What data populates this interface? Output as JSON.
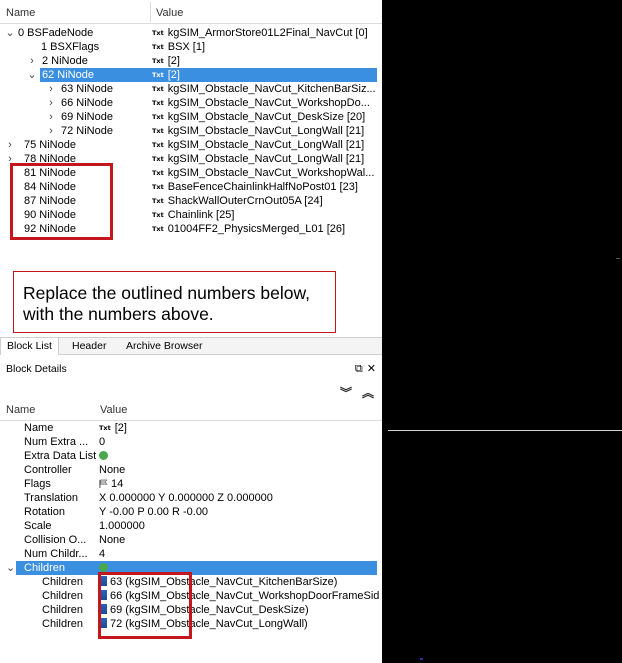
{
  "tree": {
    "col_name": "Name",
    "col_value": "Value",
    "rows": [
      {
        "arrow": "⌄",
        "name": "0 BSFadeNode",
        "txt": "Txt",
        "value": "kgSIM_ArmorStore01L2Final_NavCut [0]"
      },
      {
        "arrow": "",
        "name": "1 BSXFlags",
        "txt": "Txt",
        "value": "BSX [1]"
      },
      {
        "arrow": "›",
        "name": "2 NiNode",
        "txt": "Txt",
        "value": "[2]"
      },
      {
        "arrow": "⌄",
        "name": "62 NiNode",
        "txt": "Txt",
        "value": "[2]"
      },
      {
        "arrow": "›",
        "name": "63 NiNode",
        "txt": "Txt",
        "value": "kgSIM_Obstacle_NavCut_KitchenBarSiz..."
      },
      {
        "arrow": "›",
        "name": "66 NiNode",
        "txt": "Txt",
        "value": "kgSIM_Obstacle_NavCut_WorkshopDo..."
      },
      {
        "arrow": "›",
        "name": "69 NiNode",
        "txt": "Txt",
        "value": "kgSIM_Obstacle_NavCut_DeskSize [20]"
      },
      {
        "arrow": "›",
        "name": "72 NiNode",
        "txt": "Txt",
        "value": "kgSIM_Obstacle_NavCut_LongWall [21]"
      },
      {
        "arrow": "›",
        "name": "75 NiNode",
        "txt": "Txt",
        "value": "kgSIM_Obstacle_NavCut_LongWall [21]"
      },
      {
        "arrow": "›",
        "name": "78 NiNode",
        "txt": "Txt",
        "value": "kgSIM_Obstacle_NavCut_LongWall [21]"
      },
      {
        "arrow": "",
        "name": "81 NiNode",
        "txt": "Txt",
        "value": "kgSIM_Obstacle_NavCut_WorkshopWal..."
      },
      {
        "arrow": "",
        "name": "84 NiNode",
        "txt": "Txt",
        "value": "BaseFenceChainlinkHalfNoPost01 [23]"
      },
      {
        "arrow": "",
        "name": "87 NiNode",
        "txt": "Txt",
        "value": "ShackWallOuterCrnOut05A [24]"
      },
      {
        "arrow": "",
        "name": "90 NiNode",
        "txt": "Txt",
        "value": "Chainlink [25]"
      },
      {
        "arrow": "",
        "name": "92 NiNode",
        "txt": "Txt",
        "value": "01004FF2_PhysicsMerged_L01 [26]"
      }
    ]
  },
  "annotation": {
    "text": "Replace the outlined numbers below, with the numbers above."
  },
  "tabs": [
    "Block List",
    "Header",
    "Archive Browser"
  ],
  "block_details": {
    "title": "Block Details",
    "col_name": "Name",
    "col_value": "Value",
    "rows": [
      {
        "name": "Name",
        "value": "[2]",
        "txt": "Txt"
      },
      {
        "name": "Num Extra ...",
        "value": "0"
      },
      {
        "name": "Extra Data List",
        "value": ""
      },
      {
        "name": "Controller",
        "value": "None"
      },
      {
        "name": "Flags",
        "value": "14"
      },
      {
        "name": "Translation",
        "value": "X 0.000000 Y 0.000000 Z 0.000000"
      },
      {
        "name": "Rotation",
        "value": "Y -0.00 P 0.00 R -0.00"
      },
      {
        "name": "Scale",
        "value": "1.000000"
      },
      {
        "name": "Collision O...",
        "value": "None"
      },
      {
        "name": "Num Childr...",
        "value": "4"
      },
      {
        "name": "Children",
        "value": ""
      },
      {
        "name": "Children",
        "value": "63 (kgSIM_Obstacle_NavCut_KitchenBarSize)"
      },
      {
        "name": "Children",
        "value": "66 (kgSIM_Obstacle_NavCut_WorkshopDoorFrameSid"
      },
      {
        "name": "Children",
        "value": "69 (kgSIM_Obstacle_NavCut_DeskSize)"
      },
      {
        "name": "Children",
        "value": "72 (kgSIM_Obstacle_NavCut_LongWall)"
      }
    ]
  },
  "colors": {
    "selection": "#3b8fe0",
    "outline": "#c4161c"
  }
}
